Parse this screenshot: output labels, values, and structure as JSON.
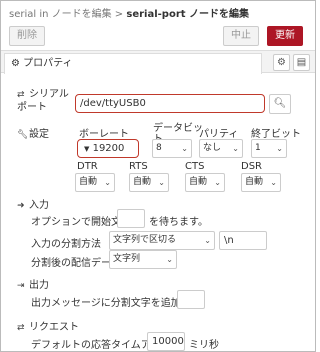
{
  "breadcrumb": {
    "prefix": "serial in ノードを編集 > ",
    "current": "serial-port ノードを編集"
  },
  "toolbar": {
    "delete_label": "削除",
    "cancel_label": "中止",
    "update_label": "更新"
  },
  "tab": {
    "label": "プロパティ"
  },
  "serial_port": {
    "label_line1": "シリアル",
    "label_line2": "ポート",
    "value": "/dev/ttyUSB0"
  },
  "settings": {
    "label": "設定",
    "baudrate_label": "ボーレート",
    "baudrate_value": "19200",
    "databits_label_line1": "データビッ",
    "databits_label_line2": "ト",
    "databits_value": "8",
    "parity_label": "パリティ",
    "parity_value": "なし",
    "stopbits_label": "終了ビット",
    "stopbits_value": "1",
    "dtr_label": "DTR",
    "dtr_value": "自動",
    "rts_label": "RTS",
    "rts_value": "自動",
    "cts_label": "CTS",
    "cts_value": "自動",
    "dsr_label": "DSR",
    "dsr_value": "自動"
  },
  "input": {
    "title": "入力",
    "start_char_prefix": "オプションで開始文字",
    "start_char_suffix": "を待ちます。",
    "split_label": "入力の分割方法",
    "split_value": "文字列で区切る",
    "split_char": "\\n",
    "deliver_label": "分割後の配信データ",
    "deliver_value": "文字列"
  },
  "output": {
    "title": "出力",
    "add_char_label": "出力メッセージに分割文字を追加する"
  },
  "request": {
    "title": "リクエスト",
    "timeout_label": "デフォルトの応答タイムアウト",
    "timeout_value": "10000",
    "timeout_unit": "ミリ秒"
  },
  "colors": {
    "accent": "#ad1625",
    "highlight": "#c0392b"
  }
}
